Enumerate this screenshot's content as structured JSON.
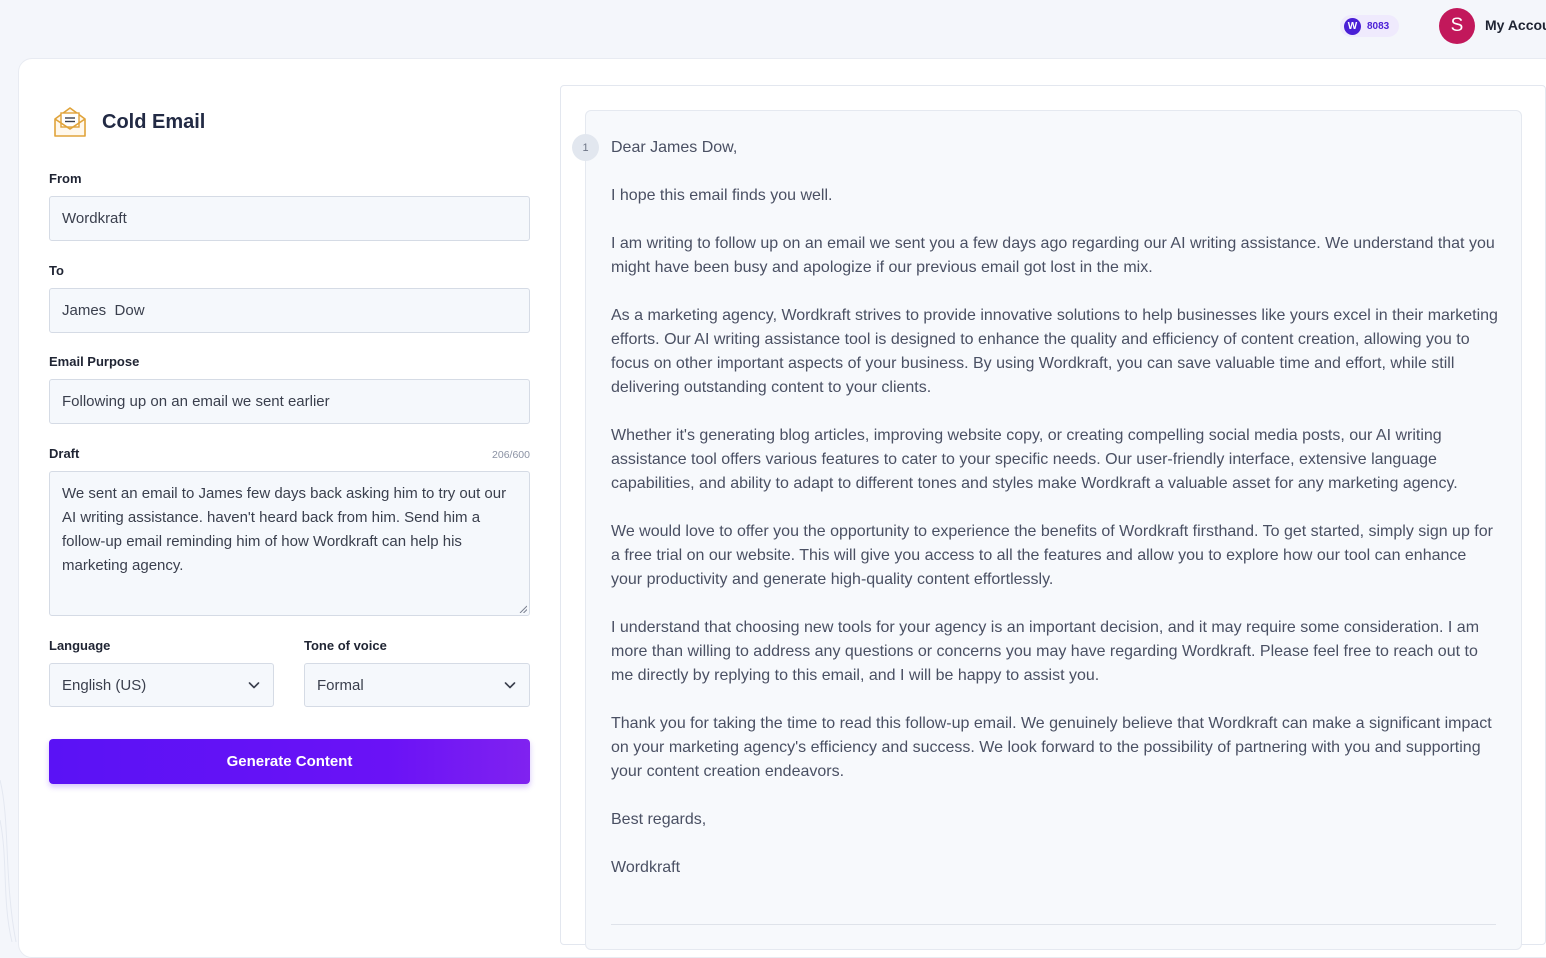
{
  "header": {
    "credits_badge_letter": "W",
    "credits_count": "8083",
    "avatar_initial": "S",
    "account_label": "My Account"
  },
  "form": {
    "title": "Cold Email",
    "from": {
      "label": "From",
      "value": "Wordkraft"
    },
    "to": {
      "label": "To",
      "value": "James  Dow"
    },
    "purpose": {
      "label": "Email Purpose",
      "value": "Following up on an email we sent earlier"
    },
    "draft": {
      "label": "Draft",
      "counter": "206/600",
      "value": "We sent an email to James few days back asking him to try out our AI writing assistance. haven't heard back from him. Send him a follow-up email reminding him of how Wordkraft can help his marketing agency."
    },
    "language": {
      "label": "Language",
      "value": "English (US)"
    },
    "tone": {
      "label": "Tone of voice",
      "value": "Formal"
    },
    "generate_label": "Generate Content"
  },
  "output": {
    "line_number": "1",
    "paragraphs": [
      "Dear James Dow,",
      "I hope this email finds you well.",
      "I am writing to follow up on an email we sent you a few days ago regarding our AI writing assistance. We understand that you might have been busy and apologize if our previous email got lost in the mix.",
      "As a marketing agency, Wordkraft strives to provide innovative solutions to help businesses like yours excel in their marketing efforts. Our AI writing assistance tool is designed to enhance the quality and efficiency of content creation, allowing you to focus on other important aspects of your business. By using Wordkraft, you can save valuable time and effort, while still delivering outstanding content to your clients.",
      "Whether it's generating blog articles, improving website copy, or creating compelling social media posts, our AI writing assistance tool offers various features to cater to your specific needs. Our user-friendly interface, extensive language capabilities, and ability to adapt to different tones and styles make Wordkraft a valuable asset for any marketing agency.",
      "We would love to offer you the opportunity to experience the benefits of Wordkraft firsthand. To get started, simply sign up for a free trial on our website. This will give you access to all the features and allow you to explore how our tool can enhance your productivity and generate high-quality content effortlessly.",
      "I understand that choosing new tools for your agency is an important decision, and it may require some consideration. I am more than willing to address any questions or concerns you may have regarding Wordkraft. Please feel free to reach out to me directly by replying to this email, and I will be happy to assist you.",
      "Thank you for taking the time to read this follow-up email. We genuinely believe that Wordkraft can make a significant impact on your marketing agency's efficiency and success. We look forward to the possibility of partnering with you and supporting your content creation endeavors.",
      "Best regards,",
      "Wordkraft"
    ]
  },
  "icons": {
    "envelope": "envelope-icon",
    "chevron": "chevron-down-icon",
    "credits": "credits-icon"
  },
  "colors": {
    "accent": "#5a12f5",
    "avatar": "#c2185b",
    "envelope_stroke": "#e0a33a"
  }
}
